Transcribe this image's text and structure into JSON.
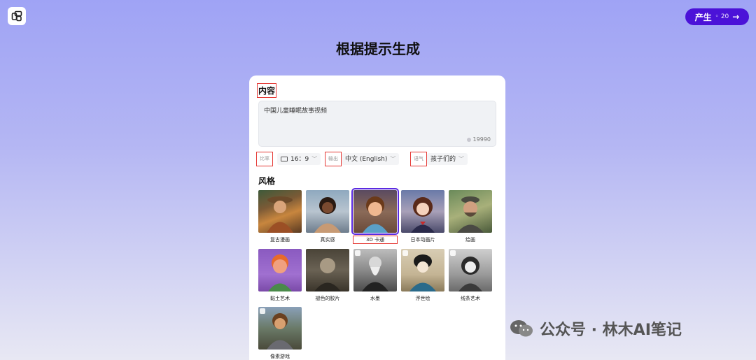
{
  "header": {
    "produce_label": "产生",
    "credits": "20"
  },
  "page_title": "根据提示生成",
  "content": {
    "label": "内容",
    "prompt_text": "中国儿童睡眠故事视频",
    "char_count": "19990"
  },
  "options": {
    "ratio_tag": "比率",
    "ratio_value": "16：9",
    "output_tag": "输出",
    "output_value": "中文 (English)",
    "tone_tag": "语气",
    "tone_value": "孩子们的"
  },
  "style": {
    "label": "风格",
    "items": [
      {
        "label": "复古漫画",
        "locked": false,
        "selected": false
      },
      {
        "label": "真实感",
        "locked": false,
        "selected": false
      },
      {
        "label": "3D 卡通",
        "locked": false,
        "selected": true
      },
      {
        "label": "日本动画片",
        "locked": false,
        "selected": false
      },
      {
        "label": "绘画",
        "locked": false,
        "selected": false
      },
      {
        "label": "黏土艺术",
        "locked": false,
        "selected": false
      },
      {
        "label": "褪色的胶片",
        "locked": false,
        "selected": false
      },
      {
        "label": "水墨",
        "locked": true,
        "selected": false
      },
      {
        "label": "浮世绘",
        "locked": true,
        "selected": false
      },
      {
        "label": "线条艺术",
        "locked": true,
        "selected": false
      },
      {
        "label": "像素游戏",
        "locked": true,
        "selected": false
      }
    ]
  },
  "watermark": {
    "text": "公众号 · 林木AI笔记"
  }
}
